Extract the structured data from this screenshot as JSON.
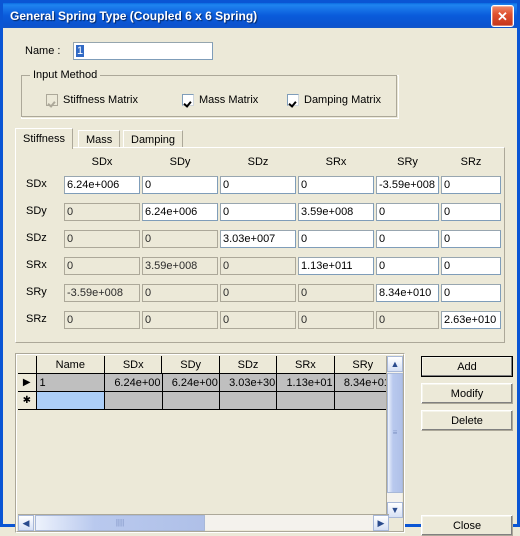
{
  "window": {
    "title": "General Spring Type (Coupled 6 x 6 Spring)",
    "close_icon": "close-icon",
    "close_glyph": "✕",
    "accent": "#0A55D4",
    "face": "#ECE9D8"
  },
  "name_field": {
    "label": "Name :",
    "value": "1",
    "placeholder": ""
  },
  "input_method": {
    "legend": "Input Method",
    "options": [
      {
        "label": "Stiffness Matrix",
        "checked": true,
        "disabled": true
      },
      {
        "label": "Mass Matrix",
        "checked": true,
        "disabled": false
      },
      {
        "label": "Damping Matrix",
        "checked": true,
        "disabled": false
      }
    ]
  },
  "tabs": [
    {
      "label": "Stiffness",
      "active": true
    },
    {
      "label": "Mass",
      "active": false
    },
    {
      "label": "Damping",
      "active": false
    }
  ],
  "matrix": {
    "columns": [
      "SDx",
      "SDy",
      "SDz",
      "SRx",
      "SRy",
      "SRz"
    ],
    "rows": [
      "SDx",
      "SDy",
      "SDz",
      "SRx",
      "SRy",
      "SRz"
    ],
    "values": [
      [
        "6.24e+006",
        "0",
        "0",
        "0",
        "-3.59e+008",
        "0"
      ],
      [
        "0",
        "6.24e+006",
        "0",
        "3.59e+008",
        "0",
        "0"
      ],
      [
        "0",
        "0",
        "3.03e+007",
        "0",
        "0",
        "0"
      ],
      [
        "0",
        "3.59e+008",
        "0",
        "1.13e+011",
        "0",
        "0"
      ],
      [
        "-3.59e+008",
        "0",
        "0",
        "0",
        "8.34e+010",
        "0"
      ],
      [
        "0",
        "0",
        "0",
        "0",
        "0",
        "2.63e+010"
      ]
    ],
    "readonly": [
      [
        false,
        false,
        false,
        false,
        false,
        false
      ],
      [
        true,
        false,
        false,
        false,
        false,
        false
      ],
      [
        true,
        true,
        false,
        false,
        false,
        false
      ],
      [
        true,
        true,
        true,
        false,
        false,
        false
      ],
      [
        true,
        true,
        true,
        true,
        false,
        false
      ],
      [
        true,
        true,
        true,
        true,
        true,
        false
      ]
    ]
  },
  "grid": {
    "columns": [
      "Name",
      "SDx",
      "SDy",
      "SDz",
      "SRx",
      "SRy"
    ],
    "rows": [
      {
        "indicator": "▶",
        "selected": false,
        "cells": [
          "1",
          "6.24e+00",
          "6.24e+00",
          "3.03e+30",
          "1.13e+01",
          "8.34e+01"
        ]
      },
      {
        "indicator": "✱",
        "selected": true,
        "cells": [
          "",
          "",
          "",
          "",
          "",
          ""
        ]
      }
    ],
    "vscroll": {
      "up_glyph": "▲",
      "down_glyph": "▼",
      "grip": "≡"
    },
    "hscroll": {
      "left_glyph": "◀",
      "right_glyph": "▶",
      "grip": "||||"
    }
  },
  "buttons": {
    "add": "Add",
    "modify": "Modify",
    "delete": "Delete",
    "close": "Close"
  }
}
